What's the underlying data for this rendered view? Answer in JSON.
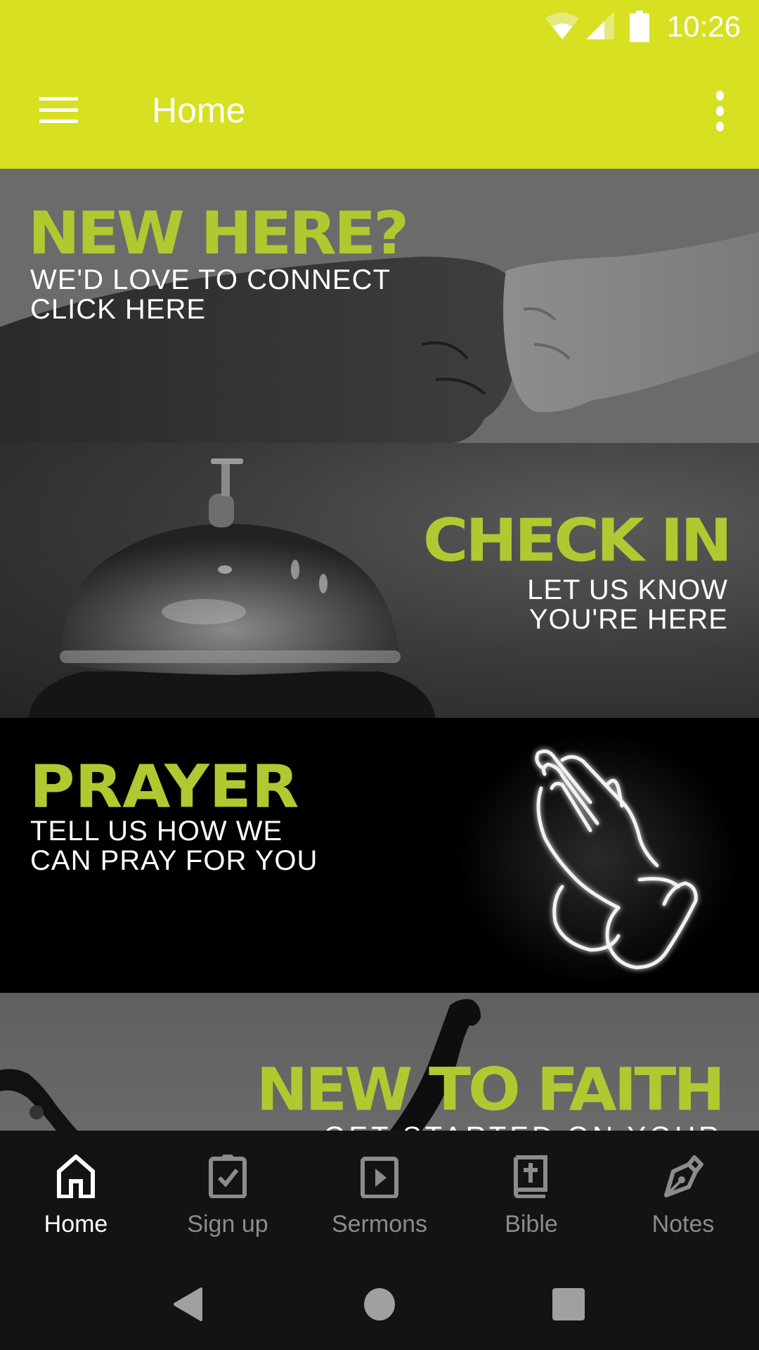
{
  "status_bar": {
    "time": "10:26",
    "icons": [
      "wifi-icon",
      "signal-icon",
      "battery-icon"
    ]
  },
  "app_bar": {
    "title": "Home",
    "menu_icon": "hamburger-menu-icon",
    "overflow_icon": "more-vert-icon",
    "background_color": "#d7e021"
  },
  "banners": [
    {
      "headline": "NEW HERE?",
      "subtitle_lines": [
        "WE'D LOVE TO CONNECT",
        "CLICK HERE"
      ],
      "image": "fist-bump-photo"
    },
    {
      "headline": "CHECK IN",
      "subtitle_lines": [
        "LET US KNOW",
        "YOU'RE HERE"
      ],
      "image": "service-bell-photo"
    },
    {
      "headline": "PRAYER",
      "subtitle_lines": [
        "TELL US HOW WE",
        "CAN PRAY FOR YOU"
      ],
      "image": "neon-praying-hands-photo"
    },
    {
      "headline": "NEW TO FAITH",
      "subtitle_lines": [
        "GET STARTED ON YOUR"
      ],
      "image": "raised-hands-photo"
    }
  ],
  "accent_color": "#b0c931",
  "bottom_nav": {
    "items": [
      {
        "label": "Home",
        "icon": "home-icon",
        "active": true
      },
      {
        "label": "Sign up",
        "icon": "clipboard-check-icon",
        "active": false
      },
      {
        "label": "Sermons",
        "icon": "play-video-icon",
        "active": false
      },
      {
        "label": "Bible",
        "icon": "bible-icon",
        "active": false
      },
      {
        "label": "Notes",
        "icon": "pen-nib-icon",
        "active": false
      }
    ]
  },
  "system_nav": [
    "back-icon",
    "home-circle-icon",
    "recents-icon"
  ]
}
